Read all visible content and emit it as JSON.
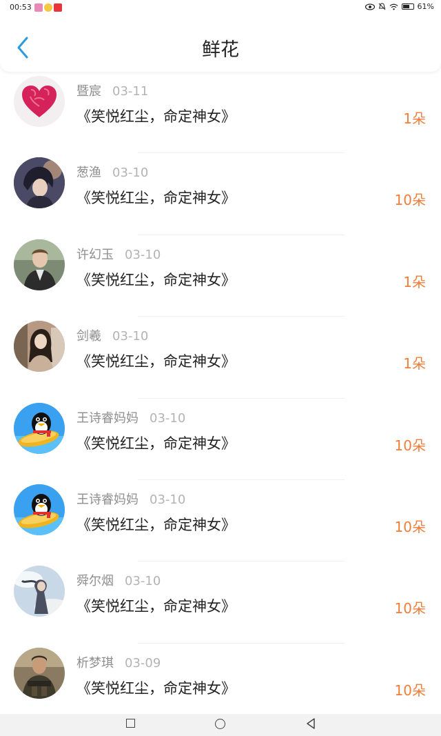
{
  "status_bar": {
    "time": "00:53",
    "battery": "61%"
  },
  "header": {
    "title": "鲜花"
  },
  "colors": {
    "count": "#f07d3a",
    "accent": "#2b9be0",
    "name": "#8e8e8e",
    "date": "#b3b3b3"
  },
  "items": [
    {
      "name": "暨宸",
      "date": "03-11",
      "book": "《笑悦红尘，命定神女》",
      "count": "1朵",
      "avatar": "heart-roses"
    },
    {
      "name": "葱渔",
      "date": "03-10",
      "book": "《笑悦红尘，命定神女》",
      "count": "10朵",
      "avatar": "anime-boy"
    },
    {
      "name": "许幻玉",
      "date": "03-10",
      "book": "《笑悦红尘，命定神女》",
      "count": "1朵",
      "avatar": "man-photo"
    },
    {
      "name": "剑羲",
      "date": "03-10",
      "book": "《笑悦红尘，命定神女》",
      "count": "1朵",
      "avatar": "woman-photo"
    },
    {
      "name": "王诗睿妈妈",
      "date": "03-10",
      "book": "《笑悦红尘，命定神女》",
      "count": "10朵",
      "avatar": "qq-penguin"
    },
    {
      "name": "王诗睿妈妈",
      "date": "03-10",
      "book": "《笑悦红尘，命定神女》",
      "count": "10朵",
      "avatar": "qq-penguin"
    },
    {
      "name": "舜尔烟",
      "date": "03-10",
      "book": "《笑悦红尘，命定神女》",
      "count": "10朵",
      "avatar": "sky-girl"
    },
    {
      "name": "析梦琪",
      "date": "03-09",
      "book": "《笑悦红尘，命定神女》",
      "count": "10朵",
      "avatar": "soldier-photo"
    }
  ]
}
